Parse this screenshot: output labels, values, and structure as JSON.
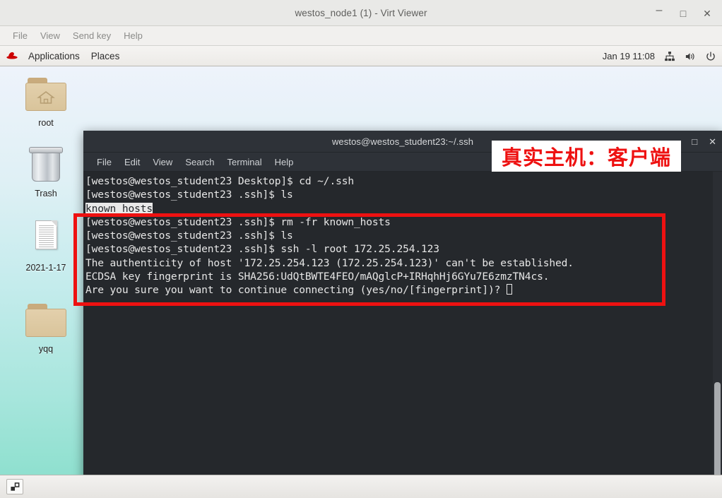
{
  "virt_viewer": {
    "title": "westos_node1 (1) - Virt Viewer",
    "window_controls": {
      "minimize": "–",
      "maximize": "□",
      "close": "✕"
    },
    "menu": [
      "File",
      "View",
      "Send key",
      "Help"
    ]
  },
  "gnome_panel": {
    "applications_label": "Applications",
    "places_label": "Places",
    "clock": "Jan 19 11:08",
    "tray": [
      "network-icon",
      "volume-icon",
      "power-icon"
    ],
    "logo": "redhat-logo-icon"
  },
  "desktop": {
    "icons": [
      {
        "label": "root",
        "type": "home-folder-icon"
      },
      {
        "label": "Trash",
        "type": "trash-icon"
      },
      {
        "label": "2021-1-17",
        "type": "document-icon"
      },
      {
        "label": "yqq",
        "type": "folder-icon"
      }
    ]
  },
  "terminal": {
    "title": "westos@westos_student23:~/.ssh",
    "window_controls": {
      "maximize": "□",
      "close": "✕"
    },
    "menu": [
      "File",
      "Edit",
      "View",
      "Search",
      "Terminal",
      "Help"
    ],
    "lines": [
      {
        "text": "[westos@westos_student23 Desktop]$ cd ~/.ssh"
      },
      {
        "text": "[westos@westos_student23 .ssh]$ ls"
      },
      {
        "text": "known_hosts",
        "highlight": true
      },
      {
        "text": "[westos@westos_student23 .ssh]$ rm -fr known_hosts"
      },
      {
        "text": "[westos@westos_student23 .ssh]$ ls"
      },
      {
        "text": "[westos@westos_student23 .ssh]$ ssh -l root 172.25.254.123"
      },
      {
        "text": "The authenticity of host '172.25.254.123 (172.25.254.123)' can't be established."
      },
      {
        "text": "ECDSA key fingerprint is SHA256:UdQtBWTE4FEO/mAQglcP+IRHqhHj6GYu7E6zmzTN4cs."
      },
      {
        "text": "Are you sure you want to continue connecting (yes/no/[fingerprint])? ",
        "cursor": true
      }
    ],
    "colors": {
      "background": "#25282c",
      "foreground": "#e6e6e6",
      "chrome": "#2e3238"
    }
  },
  "annotations": {
    "label_text": "真实主机：客户端",
    "highlight_color": "#ee1111"
  },
  "bottom_panel": {
    "workspace_switcher": "workspace-switcher-icon"
  }
}
